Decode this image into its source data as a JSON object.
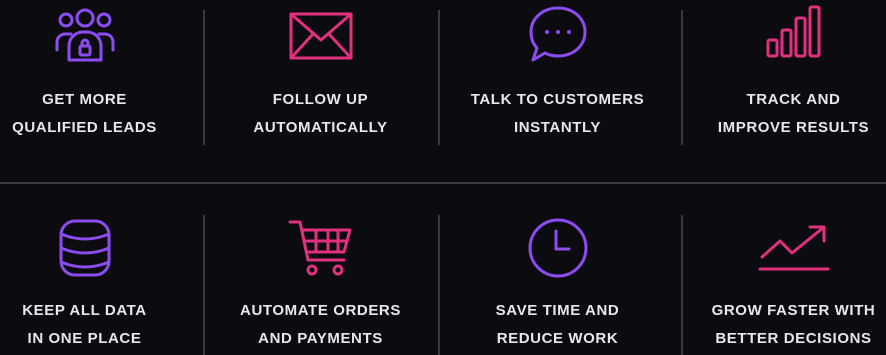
{
  "colors": {
    "background": "#0c0b10",
    "text": "#e9e7ee",
    "violet": "#8b4cf0",
    "pink": "#e1307e",
    "divider": "#3a3840"
  },
  "features": [
    {
      "icon": "users-group-icon",
      "line1": "GET MORE",
      "line2": "QUALIFIED LEADS"
    },
    {
      "icon": "envelope-icon",
      "line1": "FOLLOW UP",
      "line2": "AUTOMATICALLY"
    },
    {
      "icon": "chat-bubble-icon",
      "line1": "TALK TO CUSTOMERS",
      "line2": "INSTANTLY"
    },
    {
      "icon": "bar-chart-icon",
      "line1": "TRACK AND",
      "line2": "IMPROVE RESULTS"
    },
    {
      "icon": "database-icon",
      "line1": "KEEP ALL DATA",
      "line2": "IN ONE PLACE"
    },
    {
      "icon": "shopping-cart-icon",
      "line1": "AUTOMATE ORDERS",
      "line2": "AND PAYMENTS"
    },
    {
      "icon": "clock-icon",
      "line1": "SAVE TIME AND",
      "line2": "REDUCE WORK"
    },
    {
      "icon": "trend-up-icon",
      "line1": "GROW FASTER WITH",
      "line2": "BETTER DECISIONS"
    }
  ]
}
